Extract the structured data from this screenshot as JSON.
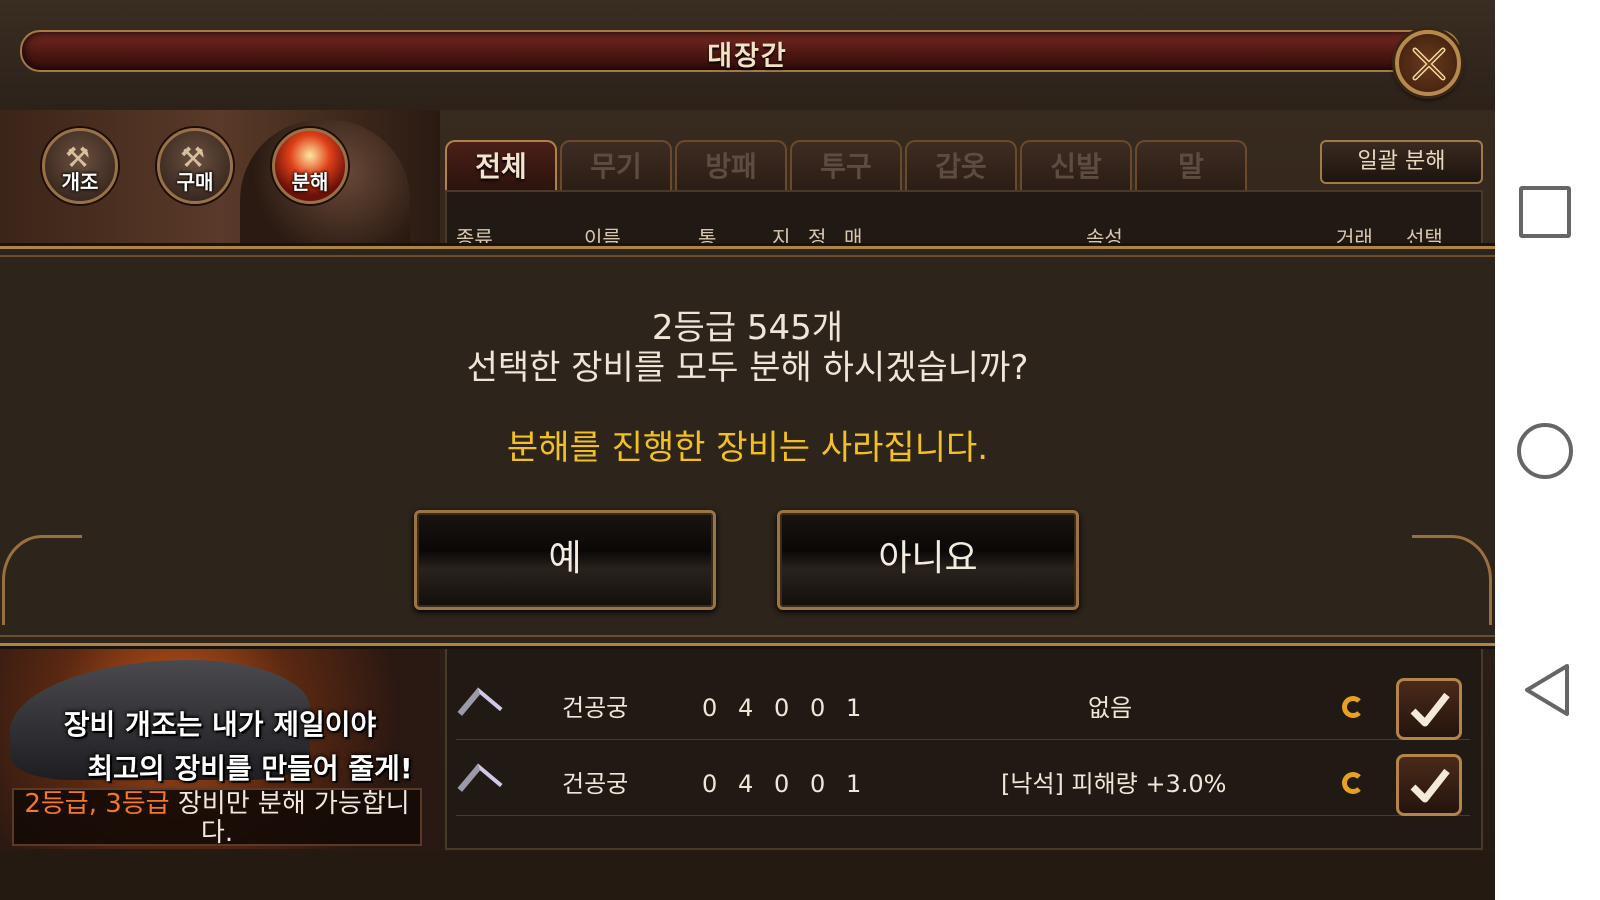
{
  "title": "대장간",
  "modes": [
    {
      "label": "개조"
    },
    {
      "label": "구매"
    },
    {
      "label": "분해"
    }
  ],
  "tabs": [
    "전체",
    "무기",
    "방패",
    "투구",
    "갑옷",
    "신발",
    "말"
  ],
  "bulk_button": "일괄 분해",
  "table_headers": {
    "type": "종류",
    "name": "이름",
    "stat1": "통",
    "stat2": "지",
    "stat3": "정",
    "stat4": "매",
    "attribute": "속성",
    "trade": "거래",
    "select": "선택"
  },
  "dialog": {
    "line1": "2등급 545개",
    "line2": "선택한 장비를 모두 분해 하시겠습니까?",
    "warning": "분해를 진행한 장비는 사라집니다.",
    "yes": "예",
    "no": "아니요"
  },
  "promo": {
    "line1": "장비 개조는 내가 제일이야",
    "line2": "최고의 장비를 만들어 줄게!"
  },
  "notice": {
    "highlight": "2등급, 3등급",
    "text": " 장비만 분해 가능합니다."
  },
  "rows": [
    {
      "name": "건공궁",
      "v1": "0",
      "v2": "4",
      "v3": "0",
      "v4": "0",
      "v5": "1",
      "attribute": "없음"
    },
    {
      "name": "건공궁",
      "v1": "0",
      "v2": "4",
      "v3": "0",
      "v4": "0",
      "v5": "1",
      "attribute": "[낙석] 피해량 +3.0%"
    }
  ],
  "colors": {
    "warning": "#f2c020",
    "highlight": "#f2782a",
    "frame_gold": "#b08446"
  },
  "icons": [
    "close-icon",
    "hammer-icon",
    "purchase-icon",
    "dismantle-icon",
    "bow-icon",
    "coin-icon",
    "checkmark-icon",
    "square-nav-icon",
    "circle-nav-icon",
    "back-nav-icon"
  ]
}
